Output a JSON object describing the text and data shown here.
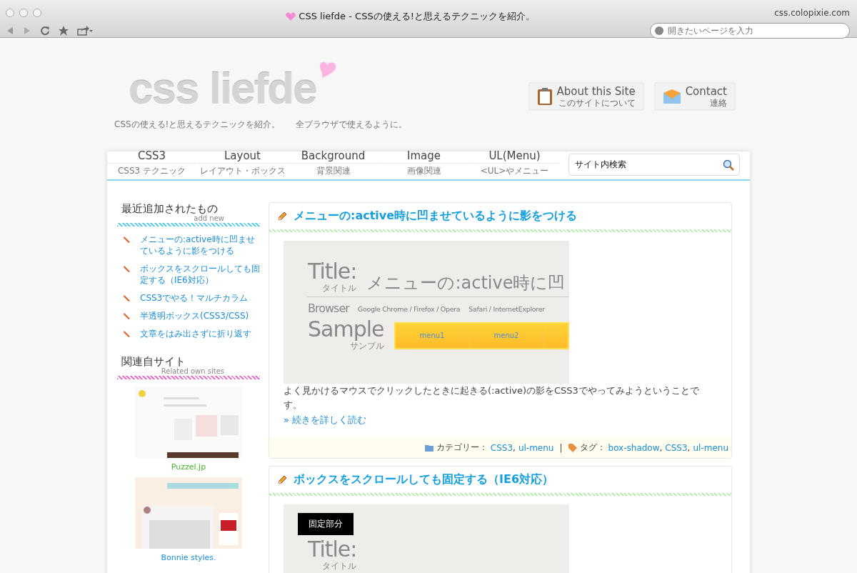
{
  "browser": {
    "title": "CSS liefde - CSSの使える!と思えるテクニックを紹介。",
    "url": "css.colopixie.com",
    "address_placeholder": "開きたいページを入力"
  },
  "header": {
    "logo": "css liefde",
    "taglines": [
      "CSSの使える!と思えるテクニックを紹介。",
      "全ブラウザで使えるように。"
    ],
    "buttons": [
      {
        "kind": "about",
        "label": "About this Site",
        "sublabel": "このサイトについて"
      },
      {
        "kind": "contact",
        "label": "Contact",
        "sublabel": "連絡"
      }
    ]
  },
  "nav": {
    "items": [
      {
        "label": "CSS3",
        "sublabel": "CSS3 テクニック"
      },
      {
        "label": "Layout",
        "sublabel": "レイアウト・ボックス"
      },
      {
        "label": "Background",
        "sublabel": "背景関連"
      },
      {
        "label": "Image",
        "sublabel": "画像関連"
      },
      {
        "label": "UL(Menu)",
        "sublabel": "<UL>やメニュー"
      }
    ],
    "search": {
      "placeholder": "サイト内検索"
    }
  },
  "sidebar": {
    "recent": {
      "title": "最近追加されたもの",
      "subtitle": "add new",
      "items": [
        "メニューの:active時に凹ませているように影をつける",
        "ボックスをスクロールしても固定する（IE6対応）",
        "CSS3でやる！マルチカラム",
        "半透明ボックス(CSS3/CSS)",
        "文章をはみ出さずに折り返す"
      ]
    },
    "related": {
      "title": "関連自サイト",
      "subtitle": "Related own sites",
      "sites": [
        {
          "name": "Puzzel.jp",
          "color": "#4cb32c"
        },
        {
          "name": "Bonnie styles.",
          "color": "#1a8fd8"
        }
      ]
    }
  },
  "posts": [
    {
      "title": "メニューの:active時に凹ませているように影をつける",
      "screenshot": {
        "title_label": "Title:",
        "title_sub": "タイトル",
        "title_text": "メニューの:active時に凹",
        "browser_label": "Browser",
        "browsers": [
          "Google Chrome / Firefox / Opera",
          "Safari / InternetExplorer"
        ],
        "sample_label": "Sample",
        "sample_sub": "サンプル",
        "menu_items": [
          "menu1",
          "menu2"
        ]
      },
      "body": "よく見かけるマウスでクリックしたときに起きる(:active)の影をCSS3でやってみようということです。",
      "more": "» 続きを詳しく読む",
      "footer": {
        "separator": ",",
        "divider": "|",
        "category_label": "カテゴリー：",
        "categories": [
          "CSS3",
          "ul-menu"
        ],
        "tag_label": "タグ：",
        "tags": [
          "box-shadow",
          "CSS3",
          "ul-menu"
        ]
      }
    },
    {
      "title": "ボックスをスクロールしても固定する（IE6対応）",
      "screenshot": {
        "badge": "固定部分",
        "title_label": "Title:",
        "title_sub": "タイトル"
      }
    }
  ]
}
